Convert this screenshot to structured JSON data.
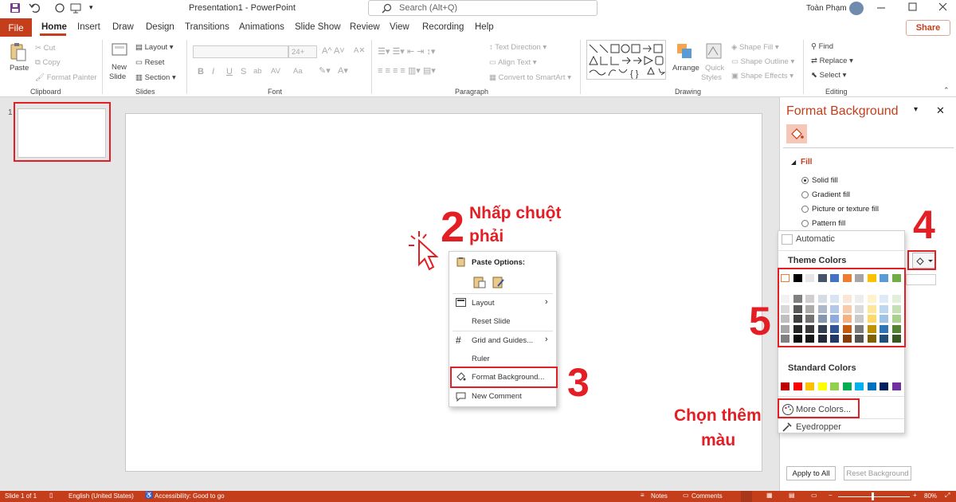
{
  "window": {
    "title": "Presentation1  -  PowerPoint",
    "search_placeholder": "Search (Alt+Q)",
    "user_name": "Toàn Phạm"
  },
  "tabs": [
    "File",
    "Home",
    "Insert",
    "Draw",
    "Design",
    "Transitions",
    "Animations",
    "Slide Show",
    "Review",
    "View",
    "Recording",
    "Help"
  ],
  "share_label": "Share",
  "ribbon": {
    "clipboard": {
      "paste": "Paste",
      "cut": "Cut",
      "copy": "Copy",
      "format_painter": "Format Painter",
      "group": "Clipboard"
    },
    "slides": {
      "new_slide_1": "New",
      "new_slide_2": "Slide",
      "layout": "Layout",
      "reset": "Reset",
      "section": "Section",
      "group": "Slides"
    },
    "font": {
      "size": "24+",
      "bold": "B",
      "italic": "I",
      "underline": "U",
      "strike": "S",
      "shadow": "ab",
      "spacing": "AV",
      "case": "Aa",
      "group": "Font"
    },
    "paragraph": {
      "text_direction": "Text Direction",
      "align_text": "Align Text",
      "smartart": "Convert to SmartArt",
      "group": "Paragraph"
    },
    "drawing": {
      "arrange": "Arrange",
      "quick_styles_1": "Quick",
      "quick_styles_2": "Styles",
      "shape_fill": "Shape Fill",
      "shape_outline": "Shape Outline",
      "shape_effects": "Shape Effects",
      "group": "Drawing"
    },
    "editing": {
      "find": "Find",
      "replace": "Replace",
      "select": "Select",
      "group": "Editing"
    }
  },
  "thumbnail": {
    "number": "1"
  },
  "annotations": {
    "step1": "1",
    "step2": "2",
    "step2_text_1": "Nhấp chuột",
    "step2_text_2": "phải",
    "step3": "3",
    "step4": "4",
    "step5": "5",
    "more_colors_note_1": "Chọn thêm",
    "more_colors_note_2": "màu"
  },
  "context_menu": {
    "paste_options": "Paste Options:",
    "layout": "Layout",
    "reset_slide": "Reset Slide",
    "grid_guides": "Grid and Guides...",
    "ruler": "Ruler",
    "format_background": "Format Background...",
    "new_comment": "New Comment"
  },
  "format_pane": {
    "title": "Format Background",
    "fill_section": "Fill",
    "options": [
      "Solid fill",
      "Gradient fill",
      "Picture or texture fill",
      "Pattern fill"
    ],
    "selected_option": "Solid fill",
    "apply_all": "Apply to All",
    "reset": "Reset Background"
  },
  "color_picker": {
    "automatic": "Automatic",
    "theme_colors_label": "Theme Colors",
    "theme_top": [
      "#ffffff",
      "#000000",
      "#e7e6e6",
      "#44546a",
      "#4472c4",
      "#ed7d31",
      "#a5a5a5",
      "#ffc000",
      "#5b9bd5",
      "#70ad47"
    ],
    "theme_shades": [
      [
        "#f2f2f2",
        "#d9d9d9",
        "#bfbfbf",
        "#a6a6a6",
        "#808080"
      ],
      [
        "#808080",
        "#595959",
        "#404040",
        "#262626",
        "#0d0d0d"
      ],
      [
        "#d0cece",
        "#aeaaaa",
        "#757171",
        "#3a3838",
        "#171616"
      ],
      [
        "#d6dce5",
        "#adb9ca",
        "#8497b0",
        "#333f50",
        "#222a35"
      ],
      [
        "#dae3f3",
        "#b4c7e7",
        "#8faadc",
        "#2f5597",
        "#203864"
      ],
      [
        "#fbe5d6",
        "#f8cbad",
        "#f4b183",
        "#c55a11",
        "#843c0c"
      ],
      [
        "#ededed",
        "#dbdbdb",
        "#c9c9c9",
        "#7b7b7b",
        "#525252"
      ],
      [
        "#fff2cc",
        "#ffe699",
        "#ffd966",
        "#bf9000",
        "#7f6000"
      ],
      [
        "#deebf7",
        "#bdd7ee",
        "#9dc3e6",
        "#2e75b6",
        "#1f4e79"
      ],
      [
        "#e2f0d9",
        "#c5e0b4",
        "#a9d18e",
        "#548235",
        "#385723"
      ]
    ],
    "standard_colors_label": "Standard Colors",
    "standard": [
      "#c00000",
      "#ff0000",
      "#ffc000",
      "#ffff00",
      "#92d050",
      "#00b050",
      "#00b0f0",
      "#0070c0",
      "#002060",
      "#7030a0"
    ],
    "more_colors": "More Colors...",
    "eyedropper": "Eyedropper"
  },
  "status_bar": {
    "slide": "Slide 1 of 1",
    "language": "English (United States)",
    "accessibility": "Accessibility: Good to go",
    "notes": "Notes",
    "comments": "Comments",
    "zoom": "80%"
  }
}
